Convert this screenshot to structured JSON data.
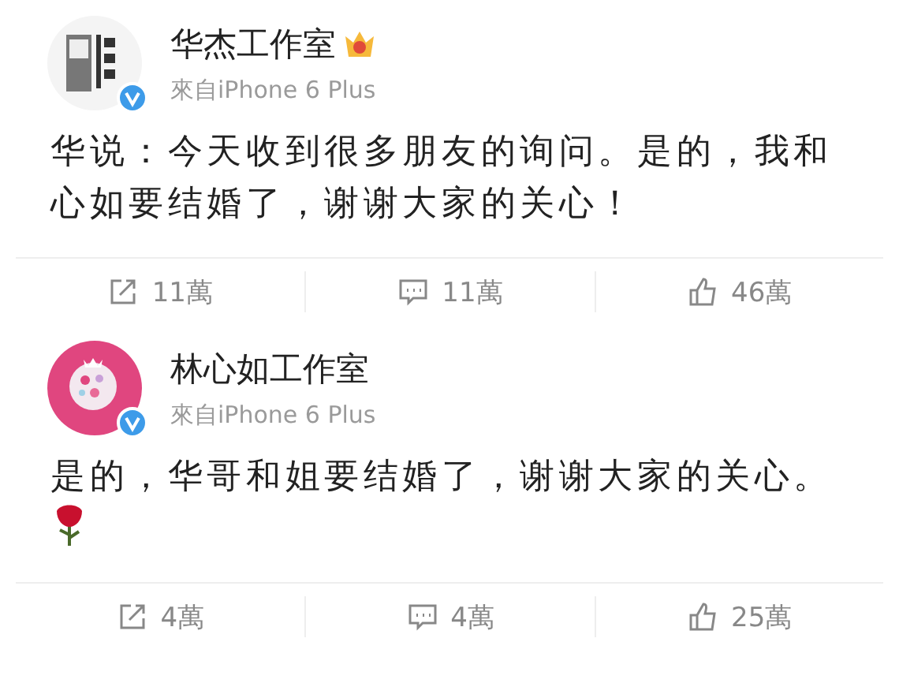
{
  "posts": [
    {
      "name": "华杰工作室",
      "kind": "logo",
      "vip_badge": true,
      "verified": true,
      "source": "來自iPhone 6 Plus",
      "text": "华说：今天收到很多朋友的询问。是的，我和心如要结婚了，谢谢大家的关心！",
      "rose": false,
      "actions": [
        {
          "kind": "repost",
          "count": "11萬"
        },
        {
          "kind": "comment",
          "count": "11萬"
        },
        {
          "kind": "like",
          "count": "46萬"
        }
      ]
    },
    {
      "name": "林心如工作室",
      "kind": "pink",
      "vip_badge": false,
      "verified": true,
      "source": "來自iPhone 6 Plus",
      "text": "是的，华哥和姐要结婚了，谢谢大家的关心。",
      "rose": true,
      "actions": [
        {
          "kind": "repost",
          "count": "4萬"
        },
        {
          "kind": "comment",
          "count": "4萬"
        },
        {
          "kind": "like",
          "count": "25萬"
        }
      ]
    }
  ]
}
